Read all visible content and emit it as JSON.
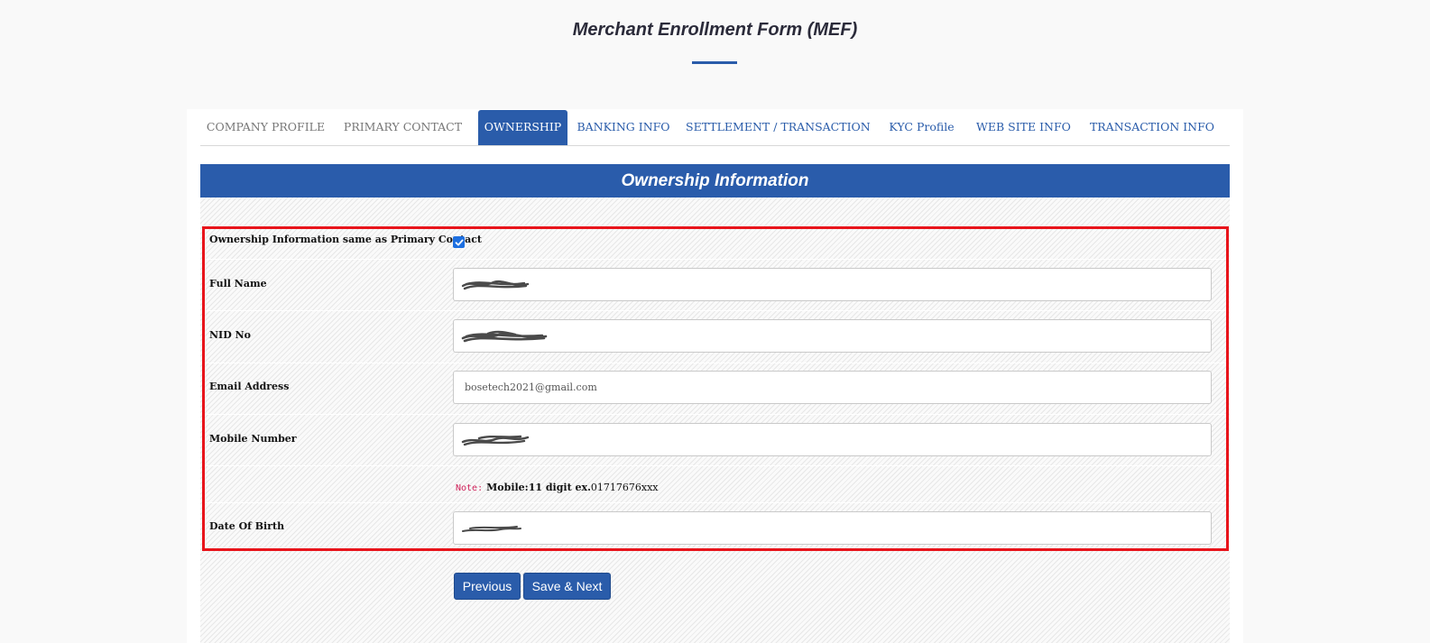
{
  "page": {
    "title": "Merchant Enrollment Form (MEF)"
  },
  "tabs": [
    {
      "label": "COMPANY PROFILE",
      "state": "visited"
    },
    {
      "label": "PRIMARY CONTACT",
      "state": "visited"
    },
    {
      "label": "OWNERSHIP",
      "state": "active"
    },
    {
      "label": "BANKING INFO",
      "state": "pending"
    },
    {
      "label": "SETTLEMENT / TRANSACTION",
      "state": "pending"
    },
    {
      "label": "KYC Profile",
      "state": "pending"
    },
    {
      "label": "WEB SITE INFO",
      "state": "pending"
    },
    {
      "label": "TRANSACTION INFO",
      "state": "pending"
    }
  ],
  "section": {
    "heading": "Ownership Information"
  },
  "form": {
    "same_as_primary": {
      "label": "Ownership Information same as Primary Contact",
      "checked": true
    },
    "full_name": {
      "label": "Full Name",
      "value": "",
      "redacted": true
    },
    "nid_no": {
      "label": "NID No",
      "value": "",
      "redacted": true
    },
    "email": {
      "label": "Email Address",
      "value": "bosetech2021@gmail.com"
    },
    "mobile": {
      "label": "Mobile Number",
      "value": "",
      "redacted": true
    },
    "mobile_note": {
      "tag": "Note:",
      "bold": "Mobile:11 digit ex.",
      "example": "01717676xxx"
    },
    "dob": {
      "label": "Date Of Birth",
      "value": "",
      "redacted": true
    }
  },
  "buttons": {
    "previous": "Previous",
    "save_next": "Save & Next"
  },
  "colors": {
    "primary": "#2a5caa",
    "highlight_border": "#e8141b",
    "note_tag": "#d0245c"
  }
}
